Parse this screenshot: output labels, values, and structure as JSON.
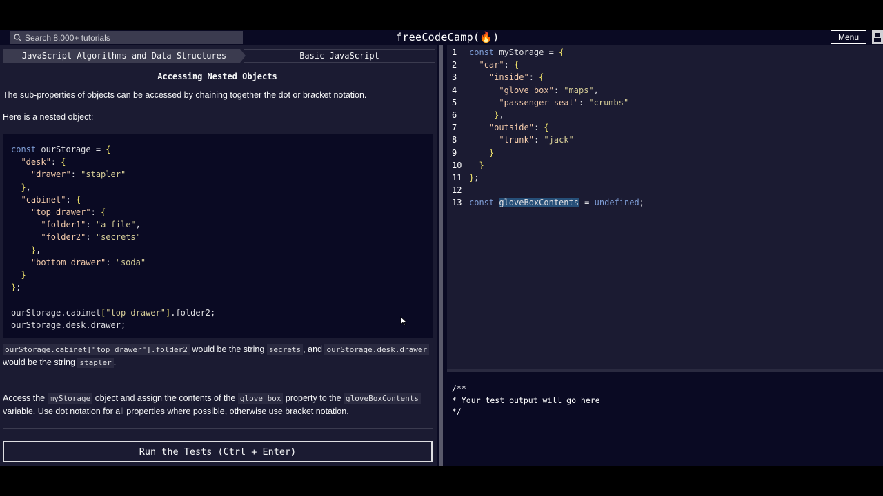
{
  "navbar": {
    "search_placeholder": "Search 8,000+ tutorials",
    "logo": "freeCodeCamp(🔥)",
    "menu_label": "Menu"
  },
  "breadcrumb": {
    "course": "JavaScript Algorithms and Data Structures",
    "section": "Basic JavaScript"
  },
  "lesson": {
    "title": "Accessing Nested Objects",
    "intro": "The sub-properties of objects can be accessed by chaining together the dot or bracket notation.",
    "example_intro": "Here is a nested object:",
    "example_code": "const ourStorage = {\n  \"desk\": {\n    \"drawer\": \"stapler\"\n  },\n  \"cabinet\": {\n    \"top drawer\": {\n      \"folder1\": \"a file\",\n      \"folder2\": \"secrets\"\n    },\n    \"bottom drawer\": \"soda\"\n  }\n};\n\nourStorage.cabinet[\"top drawer\"].folder2;\nourStorage.desk.drawer;",
    "explain": {
      "code1": "ourStorage.cabinet[\"top drawer\"].folder2",
      "text1": "would be the string",
      "code2": "secrets",
      "text2": ", and",
      "code3": "ourStorage.desk.drawer",
      "text3": "would be the string",
      "code4": "stapler",
      "text4": "."
    },
    "task": {
      "text1": "Access the",
      "code1": "myStorage",
      "text2": "object and assign the contents of the",
      "code2": "glove box",
      "text3": "property to the",
      "code3": "gloveBoxContents",
      "text4": "variable. Use dot notation for all properties where possible, otherwise use bracket notation."
    },
    "run_button": "Run the Tests (Ctrl + Enter)"
  },
  "editor": {
    "line_numbers": [
      "1",
      "2",
      "3",
      "4",
      "5",
      "6",
      "7",
      "8",
      "9",
      "10",
      "11",
      "12",
      "13"
    ],
    "lines": [
      "const myStorage = {",
      "  \"car\": {",
      "    \"inside\": {",
      "      \"glove box\": \"maps\",",
      "      \"passenger seat\": \"crumbs\"",
      "     },",
      "    \"outside\": {",
      "      \"trunk\": \"jack\"",
      "    }",
      "  }",
      "};",
      "",
      "const gloveBoxContents = undefined;"
    ]
  },
  "console": {
    "output": "/**\n* Your test output will go here\n*/"
  },
  "colors": {
    "background_dark": "#0a0a23",
    "background_panel": "#1b1b32",
    "keyword": "#7d9bd3",
    "string": "#d4cb96",
    "brace": "#f0e36b"
  },
  "icons": {
    "search": "search-icon",
    "logo_flame": "flame-icon",
    "avatar": "user-avatar-icon"
  }
}
